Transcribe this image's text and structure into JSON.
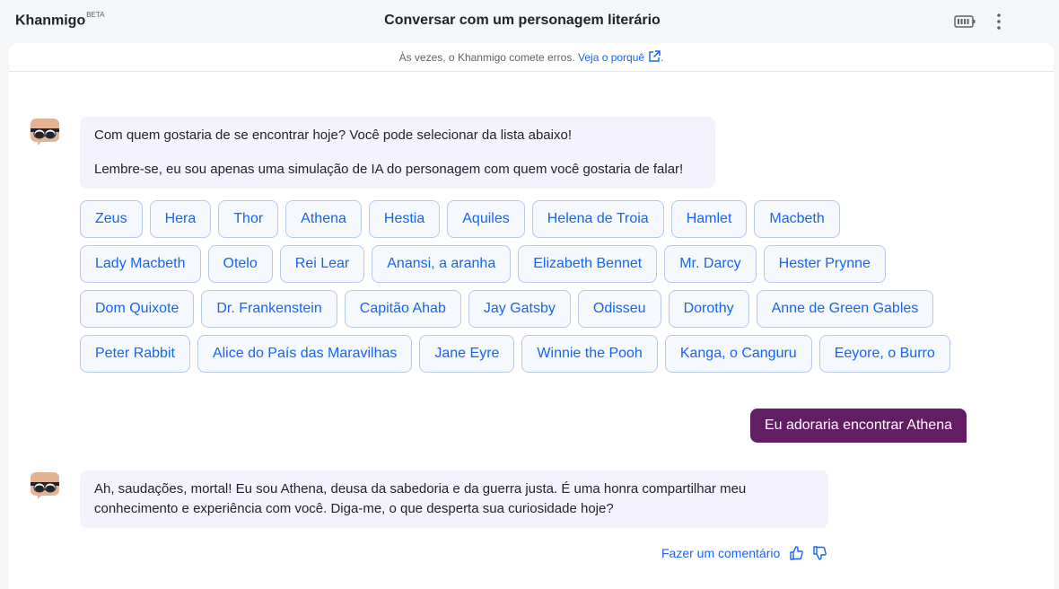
{
  "header": {
    "brand": "Khanmigo",
    "brand_tag": "BETA",
    "title": "Conversar com um personagem literário"
  },
  "notice": {
    "text": "Às vezes, o Khanmigo comete erros.",
    "link": "Veja o porquê",
    "suffix": "."
  },
  "messages": {
    "bot1_line1": "Com quem gostaria de se encontrar hoje? Você pode selecionar da lista abaixo!",
    "bot1_line2": "Lembre-se, eu sou apenas uma simulação de IA do personagem com quem você gostaria de falar!",
    "user1": "Eu adoraria encontrar Athena",
    "bot2": "Ah, saudações, mortal! Eu sou Athena, deusa da sabedoria e da guerra justa. É uma honra compartilhar meu conhecimento e experiência com você. Diga-me, o que desperta sua curiosidade hoje?"
  },
  "chip_rows": [
    [
      "Zeus",
      "Hera",
      "Thor",
      "Athena",
      "Hestia",
      "Aquiles",
      "Helena de Troia",
      "Hamlet",
      "Macbeth"
    ],
    [
      "Lady Macbeth",
      "Otelo",
      "Rei Lear",
      "Anansi, a aranha",
      "Elizabeth Bennet",
      "Mr. Darcy",
      "Hester Prynne"
    ],
    [
      "Dom Quixote",
      "Dr. Frankenstein",
      "Capitão Ahab",
      "Jay Gatsby",
      "Odisseu",
      "Dorothy",
      "Anne de Green Gables"
    ],
    [
      "Peter Rabbit",
      "Alice do País das Maravilhas",
      "Jane Eyre",
      "Winnie the Pooh",
      "Kanga, o Canguru",
      "Eeyore, o Burro"
    ]
  ],
  "feedback": {
    "label": "Fazer um comentário"
  },
  "colors": {
    "accent": "#1865f2",
    "user_bubble": "#631d62",
    "bot_bubble": "#f4f2fc"
  },
  "icons": {
    "battery": "battery-icon",
    "menu": "kebab-menu-icon",
    "external": "external-link-icon",
    "avatar": "khanmigo-avatar-icon",
    "like": "thumbs-up-icon",
    "dislike": "thumbs-down-icon"
  }
}
